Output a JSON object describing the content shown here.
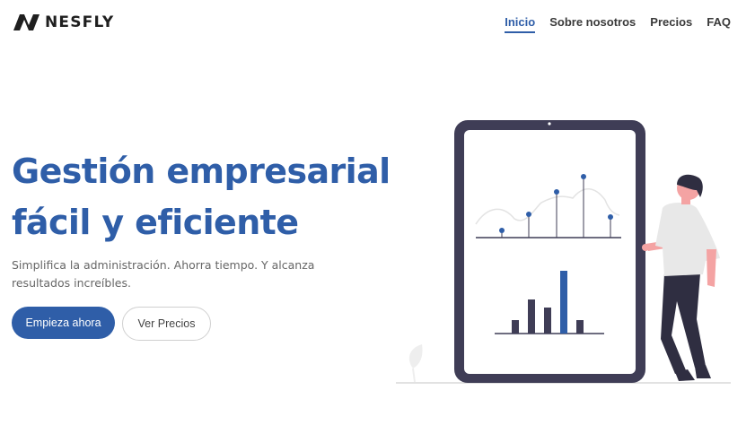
{
  "brand": {
    "name": "NESFLY",
    "logo_icon": "nesfly-logo-icon"
  },
  "nav": {
    "items": [
      {
        "label": "Inicio",
        "active": true
      },
      {
        "label": "Sobre nosotros",
        "active": false
      },
      {
        "label": "Precios",
        "active": false
      },
      {
        "label": "FAQ",
        "active": false
      }
    ]
  },
  "hero": {
    "title_line1": "Gestión empresarial",
    "title_line2": "fácil y eficiente",
    "subtitle": "Simplifica la administración. Ahorra tiempo. Y alcanza resultados increíbles.",
    "primary_cta": "Empieza ahora",
    "secondary_cta": "Ver Precios"
  },
  "colors": {
    "accent": "#2f5ea8",
    "tablet": "#3f3d56",
    "skin": "#f4a3a3"
  }
}
